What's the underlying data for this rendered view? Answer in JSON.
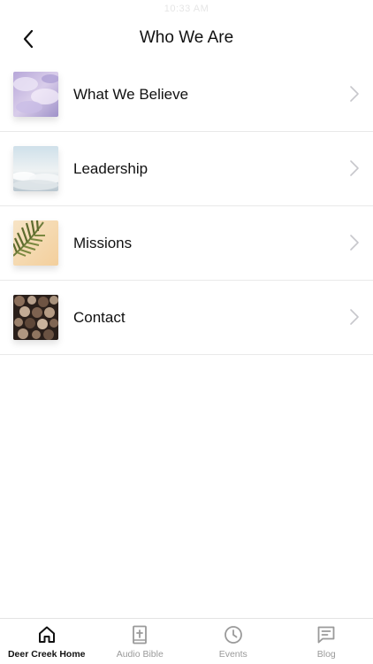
{
  "status_bar": {
    "time": "10:33 AM"
  },
  "header": {
    "title": "Who We Are",
    "back_icon": "chevron-left-icon"
  },
  "list": {
    "items": [
      {
        "label": "What We Believe",
        "thumbnail": "clouds-purple-image"
      },
      {
        "label": "Leadership",
        "thumbnail": "sky-horizon-image"
      },
      {
        "label": "Missions",
        "thumbnail": "palm-leaf-image"
      },
      {
        "label": "Contact",
        "thumbnail": "wood-logs-image"
      }
    ],
    "chevron_icon": "chevron-right-icon"
  },
  "tab_bar": {
    "tabs": [
      {
        "label": "Deer Creek Home",
        "icon": "home-icon",
        "active": true
      },
      {
        "label": "Audio Bible",
        "icon": "bible-icon",
        "active": false
      },
      {
        "label": "Events",
        "icon": "clock-icon",
        "active": false
      },
      {
        "label": "Blog",
        "icon": "message-icon",
        "active": false
      }
    ]
  },
  "colors": {
    "text": "#111111",
    "tab_inactive": "#9a9a9a",
    "divider": "#e9e9e9",
    "chevron": "#c7c7cc"
  }
}
